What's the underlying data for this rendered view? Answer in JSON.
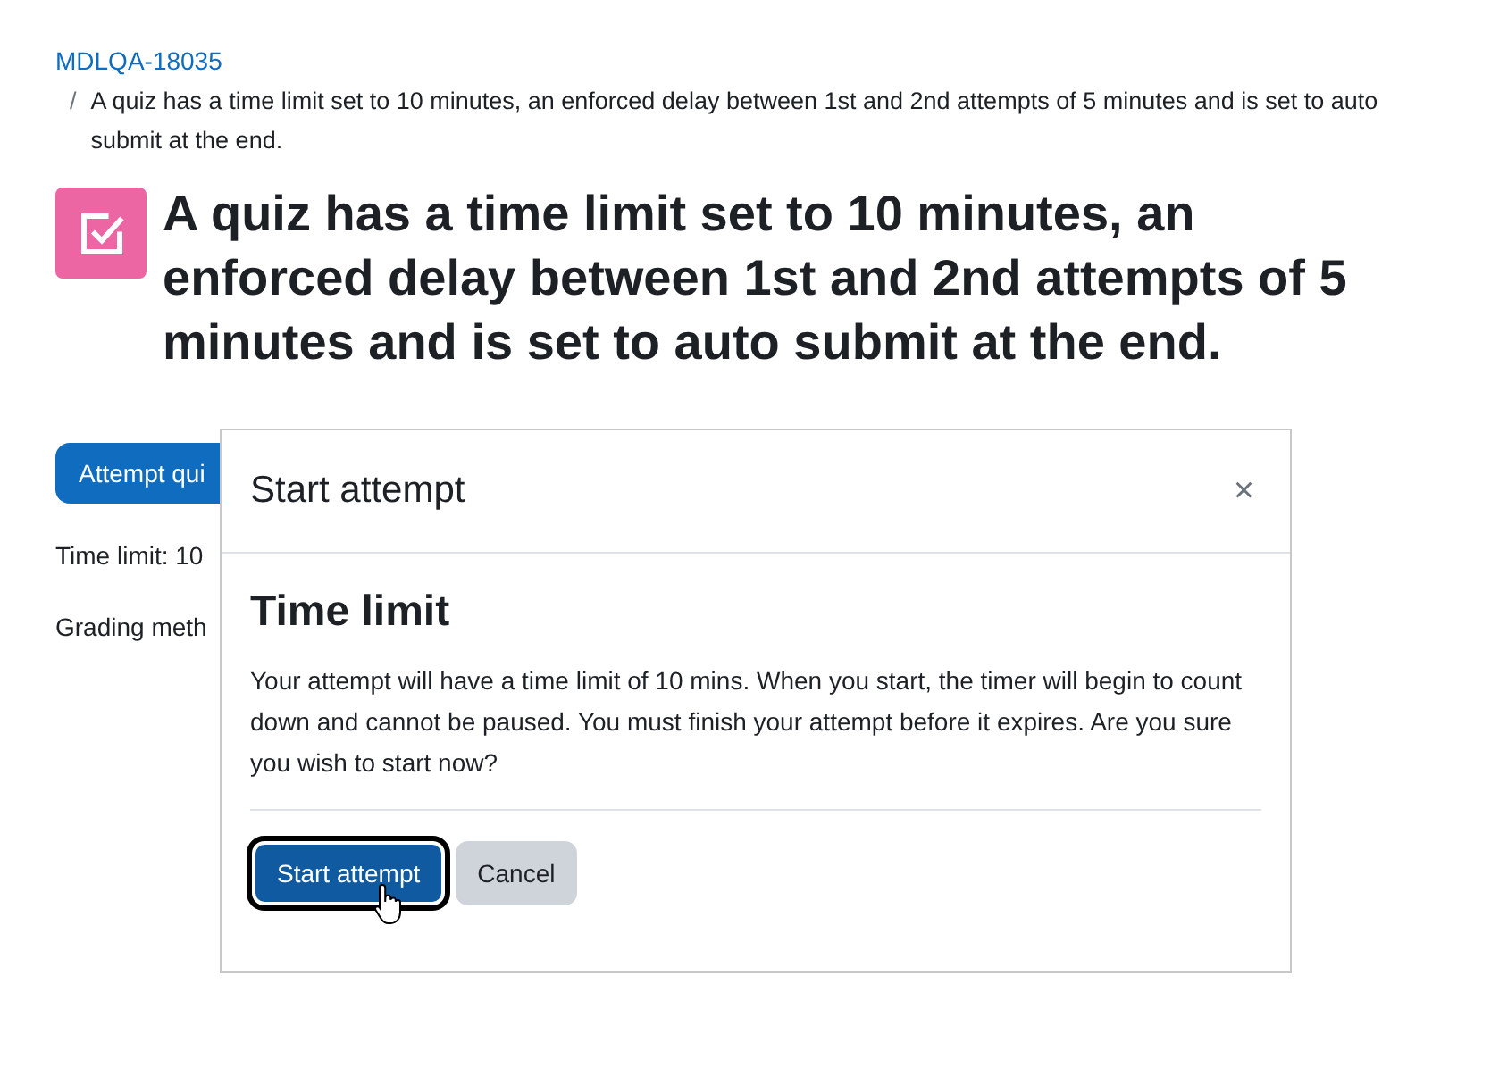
{
  "breadcrumb": {
    "link": "MDLQA-18035",
    "separator": "/",
    "current": "A quiz has a time limit set to 10 minutes, an enforced delay between 1st and 2nd attempts of 5 minutes and is set to auto submit at the end."
  },
  "page_title": "A quiz has a time limit set to 10 minutes, an enforced delay between 1st and 2nd attempts of 5 minutes and is set to auto submit at the end.",
  "attempt_button": "Attempt qui",
  "info": [
    "Time limit: 10",
    "Grading meth"
  ],
  "modal": {
    "title": "Start attempt",
    "close": "×",
    "heading": "Time limit",
    "message": "Your attempt will have a time limit of 10 mins. When you start, the timer will begin to count down and cannot be paused. You must finish your attempt before it expires. Are you sure you wish to start now?",
    "buttons": [
      {
        "label": "Start attempt",
        "kind": "primary",
        "focused": true
      },
      {
        "label": "Cancel",
        "kind": "secondary",
        "focused": false
      }
    ]
  }
}
